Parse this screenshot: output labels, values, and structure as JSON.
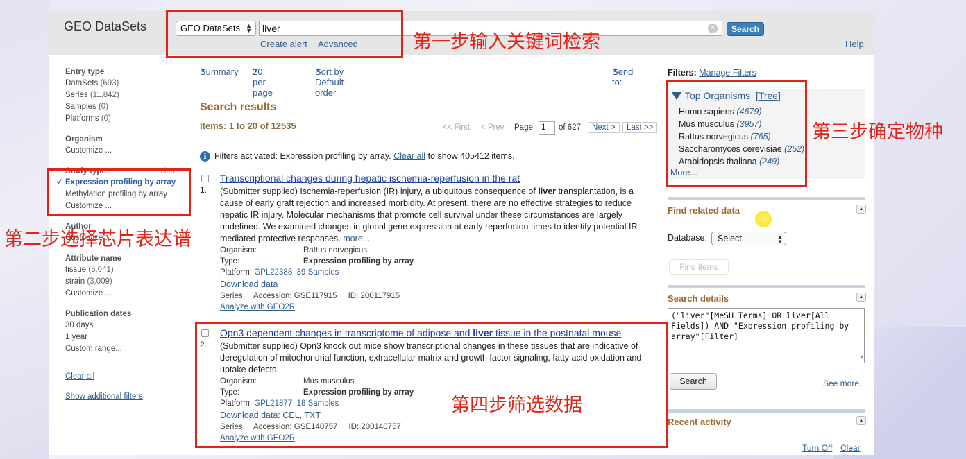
{
  "app": {
    "title": "GEO DataSets"
  },
  "header": {
    "db_select": "GEO DataSets",
    "search_value": "liver",
    "search_button": "Search",
    "create_alert": "Create alert",
    "advanced": "Advanced",
    "help": "Help"
  },
  "sidebar": {
    "entry_type": {
      "heading": "Entry type",
      "items": [
        {
          "label": "DataSets",
          "count": "(693)"
        },
        {
          "label": "Series",
          "count": "(11,842)"
        },
        {
          "label": "Samples",
          "count": "(0)"
        },
        {
          "label": "Platforms",
          "count": "(0)"
        }
      ]
    },
    "organism": {
      "heading": "Organism",
      "customize": "Customize ..."
    },
    "study_type": {
      "heading": "Study type",
      "clear": "clear",
      "items": [
        {
          "label": "Expression profiling by array",
          "active": true
        },
        {
          "label": "Methylation profiling by array",
          "active": false
        }
      ],
      "customize": "Customize ..."
    },
    "author": {
      "heading": "Author",
      "customize": "Customize ..."
    },
    "attribute_name": {
      "heading": "Attribute name",
      "items": [
        {
          "label": "tissue",
          "count": "(5,041)"
        },
        {
          "label": "strain",
          "count": "(3,009)"
        }
      ],
      "customize": "Customize ..."
    },
    "publication_dates": {
      "heading": "Publication dates",
      "items": [
        "30 days",
        "1 year",
        "Custom range..."
      ]
    },
    "clear_all": "Clear all",
    "show_additional": "Show additional filters"
  },
  "toolbar": {
    "summary": "Summary",
    "per_page": "20 per page",
    "sort": "Sort by Default order",
    "send_to": "Send to:"
  },
  "results": {
    "heading": "Search results",
    "items_count": "Items: 1 to 20 of 12535",
    "pager": {
      "first": "<< First",
      "prev": "< Prev",
      "page_label": "Page",
      "page_value": "1",
      "of": "of 627",
      "next": "Next >",
      "last": "Last >>"
    },
    "filter_note": {
      "prefix": "Filters activated: Expression profiling by array.",
      "link": "Clear all",
      "suffix": "to show 405412 items."
    },
    "items": [
      {
        "num": "1.",
        "title": "Transcriptional changes during hepatic ischemia-reperfusion in the rat",
        "desc_1": "(Submitter supplied) Ischemia-reperfusion (IR) injury, a ubiquitous consequence of ",
        "desc_bold": "liver",
        "desc_2": " transplantation, is a cause of early graft rejection and increased morbidity. At present, there are no effective strategies to reduce hepatic IR injury. Molecular mechanisms that promote cell survival under these circumstances are largely undefined. We examined changes in global gene expression at early reperfusion times to identify potential IR-mediated protective responses. ",
        "more": "more...",
        "organism_label": "Organism:",
        "organism": "Rattus norvegicus",
        "type_label": "Type:",
        "type": "Expression profiling by array",
        "platform_label": "Platform:",
        "platform": "GPL22388",
        "samples": "39 Samples",
        "download": "Download data",
        "series": "Series",
        "accession": "Accession: GSE117915",
        "id": "ID: 200117915",
        "geo2r": "Analyze with GEO2R"
      },
      {
        "num": "2.",
        "title_1": "Opn3 dependent changes in transcriptome of adipose and ",
        "title_bold": "liver",
        "title_2": " tissue in the postnatal mouse",
        "desc": "(Submitter supplied) Opn3 knock out mice show transcriptional changes in these tissues that are indicative of deregulation of mitochondrial function, extracellular matrix and growth factor signaling, fatty acid oxidation and uptake defects.",
        "organism_label": "Organism:",
        "organism": "Mus musculus",
        "type_label": "Type:",
        "type": "Expression profiling by array",
        "platform_label": "Platform:",
        "platform": "GPL21877",
        "samples": "18 Samples",
        "download": "Download data: CEL, TXT",
        "series": "Series",
        "accession": "Accession: GSE140757",
        "id": "ID: 200140757",
        "geo2r": "Analyze with GEO2R"
      }
    ]
  },
  "right": {
    "filters_label": "Filters:",
    "manage_filters": "Manage Filters",
    "top_organisms": "Top Organisms",
    "tree": "[Tree]",
    "organisms": [
      {
        "name": "Homo sapiens",
        "count": "(4679)"
      },
      {
        "name": "Mus musculus",
        "count": "(3957)"
      },
      {
        "name": "Rattus norvegicus",
        "count": "(765)"
      },
      {
        "name": "Saccharomyces cerevisiae",
        "count": "(252)"
      },
      {
        "name": "Arabidopsis thaliana",
        "count": "(249)"
      }
    ],
    "more": "More...",
    "find_related": "Find related data",
    "database_label": "Database:",
    "database_value": "Select",
    "find_items": "Find items",
    "search_details_heading": "Search details",
    "search_details": "(\"liver\"[MeSH Terms] OR liver[All Fields]) AND \"Expression profiling by array\"[Filter]",
    "search_button": "Search",
    "see_more": "See more...",
    "recent_activity": "Recent activity",
    "turn_off": "Turn Off",
    "clear": "Clear"
  },
  "annotations": {
    "step1": "第一步输入关键词检索",
    "step2": "第二步选择芯片表达谱",
    "step3": "第三步确定物种",
    "step4": "第四步筛选数据",
    "color": "#e02418"
  }
}
